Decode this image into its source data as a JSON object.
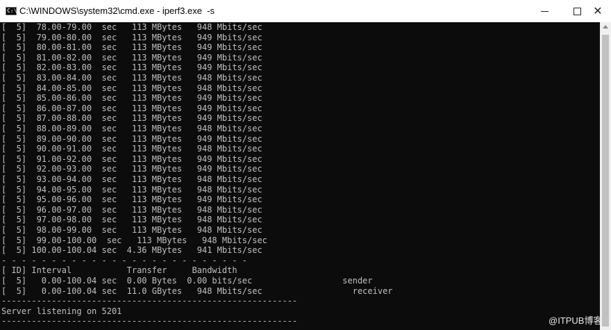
{
  "window": {
    "icon_label": "C:\\",
    "title": "C:\\WINDOWS\\system32\\cmd.exe - iperf3.exe  -s",
    "minimize_icon": "minimize-icon",
    "maximize_icon": "maximize-icon",
    "close_icon": "close-icon",
    "close_label": "✕"
  },
  "console": {
    "lines": [
      "[  5]  78.00-79.00  sec   113 MBytes   948 Mbits/sec",
      "[  5]  79.00-80.00  sec   113 MBytes   949 Mbits/sec",
      "[  5]  80.00-81.00  sec   113 MBytes   949 Mbits/sec",
      "[  5]  81.00-82.00  sec   113 MBytes   949 Mbits/sec",
      "[  5]  82.00-83.00  sec   113 MBytes   949 Mbits/sec",
      "[  5]  83.00-84.00  sec   113 MBytes   948 Mbits/sec",
      "[  5]  84.00-85.00  sec   113 MBytes   948 Mbits/sec",
      "[  5]  85.00-86.00  sec   113 MBytes   949 Mbits/sec",
      "[  5]  86.00-87.00  sec   113 MBytes   949 Mbits/sec",
      "[  5]  87.00-88.00  sec   113 MBytes   949 Mbits/sec",
      "[  5]  88.00-89.00  sec   113 MBytes   948 Mbits/sec",
      "[  5]  89.00-90.00  sec   113 MBytes   949 Mbits/sec",
      "[  5]  90.00-91.00  sec   113 MBytes   948 Mbits/sec",
      "[  5]  91.00-92.00  sec   113 MBytes   949 Mbits/sec",
      "[  5]  92.00-93.00  sec   113 MBytes   949 Mbits/sec",
      "[  5]  93.00-94.00  sec   113 MBytes   948 Mbits/sec",
      "[  5]  94.00-95.00  sec   113 MBytes   948 Mbits/sec",
      "[  5]  95.00-96.00  sec   113 MBytes   949 Mbits/sec",
      "[  5]  96.00-97.00  sec   113 MBytes   948 Mbits/sec",
      "[  5]  97.00-98.00  sec   113 MBytes   948 Mbits/sec",
      "[  5]  98.00-99.00  sec   113 MBytes   948 Mbits/sec",
      "[  5]  99.00-100.00  sec   113 MBytes   948 Mbits/sec",
      "[  5] 100.00-100.04 sec  4.36 MBytes   941 Mbits/sec",
      "- - - - - - - - - - - - - - - - - - - - - - - - -",
      "[ ID] Interval           Transfer     Bandwidth",
      "[  5]   0.00-100.04 sec  0.00 Bytes  0.00 bits/sec                  sender",
      "[  5]   0.00-100.04 sec  11.0 GBytes   948 Mbits/sec                  receiver",
      "-----------------------------------------------------------",
      "Server listening on 5201",
      "-----------------------------------------------------------"
    ]
  },
  "watermark": "@ITPUB博客"
}
